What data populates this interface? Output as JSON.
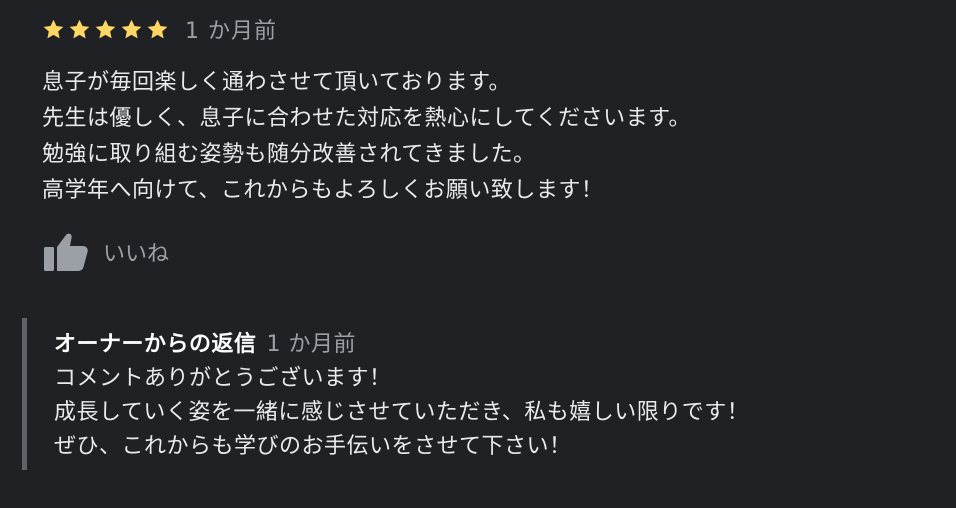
{
  "review": {
    "rating": 5,
    "max_rating": 5,
    "star_color": "#fdd663",
    "time": "1 か月前",
    "lines": [
      "息子が毎回楽しく通わさせて頂いております。",
      "先生は優しく、息子に合わせた対応を熱心にしてくださいます。",
      "勉強に取り組む姿勢も随分改善されてきました。",
      "高学年へ向けて、これからもよろしくお願い致します！"
    ]
  },
  "like": {
    "icon": "thumbs-up-icon",
    "label": "いいね"
  },
  "owner_reply": {
    "title": "オーナーからの返信",
    "time": "1 か月前",
    "lines": [
      "コメントありがとうございます！",
      "成長していく姿を一緒に感じさせていただき、私も嬉しい限りです！",
      "ぜひ、これからも学びのお手伝いをさせて下さい！"
    ]
  }
}
